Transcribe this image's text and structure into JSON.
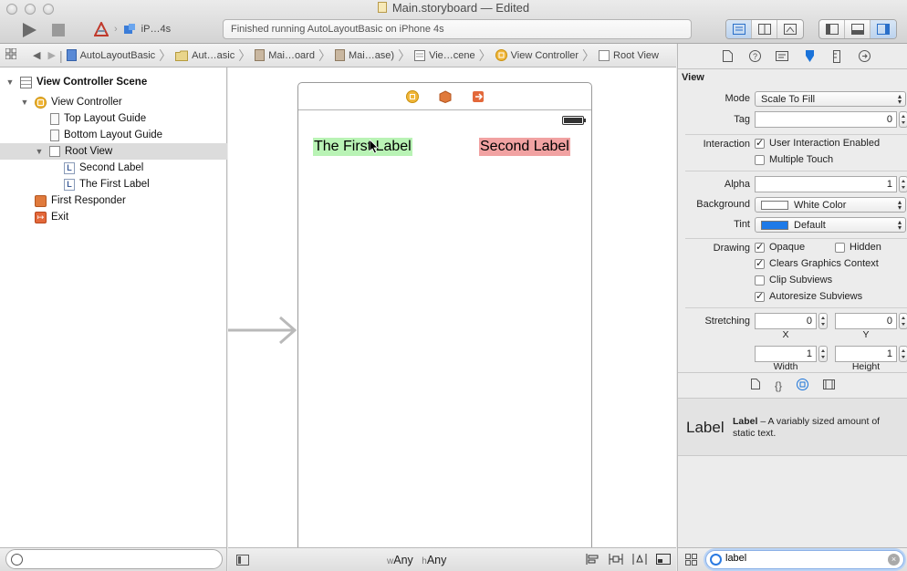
{
  "window": {
    "title": "Main.storyboard — Edited",
    "status": "Finished running AutoLayoutBasic on iPhone 4s",
    "scheme_device": "iP…4s"
  },
  "jumpbar": {
    "crumbs": [
      "AutoLayoutBasic",
      "Aut…asic",
      "Mai…oard",
      "Mai…ase)",
      "Vie…cene",
      "View Controller",
      "Root View"
    ]
  },
  "outline": {
    "scene": "View Controller Scene",
    "view_controller": "View Controller",
    "top_guide": "Top Layout Guide",
    "bottom_guide": "Bottom Layout Guide",
    "root_view": "Root View",
    "second_label": "Second Label",
    "first_label": "The First Label",
    "first_responder": "First Responder",
    "exit": "Exit"
  },
  "canvas": {
    "label_first": "The First Label",
    "label_second": "Second Label",
    "size_w_prefix": "w",
    "size_w": "Any",
    "size_h_prefix": "h",
    "size_h": "Any"
  },
  "inspector": {
    "section": "View",
    "mode_label": "Mode",
    "mode_value": "Scale To Fill",
    "tag_label": "Tag",
    "tag_value": "0",
    "interaction_label": "Interaction",
    "user_interaction": "User Interaction Enabled",
    "multiple_touch": "Multiple Touch",
    "alpha_label": "Alpha",
    "alpha_value": "1",
    "background_label": "Background",
    "background_value": "White Color",
    "tint_label": "Tint",
    "tint_value": "Default",
    "drawing_label": "Drawing",
    "opaque": "Opaque",
    "hidden": "Hidden",
    "clears_graphics": "Clears Graphics Context",
    "clip_subviews": "Clip Subviews",
    "autoresize": "Autoresize Subviews",
    "stretching_label": "Stretching",
    "stretch_x": "0",
    "stretch_y": "0",
    "stretch_w": "1",
    "stretch_h": "1",
    "x_label": "X",
    "y_label": "Y",
    "width_label": "Width",
    "height_label": "Height"
  },
  "library": {
    "item_icon": "Label",
    "item_name": "Label",
    "item_desc": " – A variably sized amount of static text.",
    "search_value": "label"
  },
  "colors": {
    "first_label_bg": "#b9f3b5",
    "second_label_bg": "#f1a2a2",
    "tint": "#1e7ae8",
    "accent": "#1a73d9"
  }
}
